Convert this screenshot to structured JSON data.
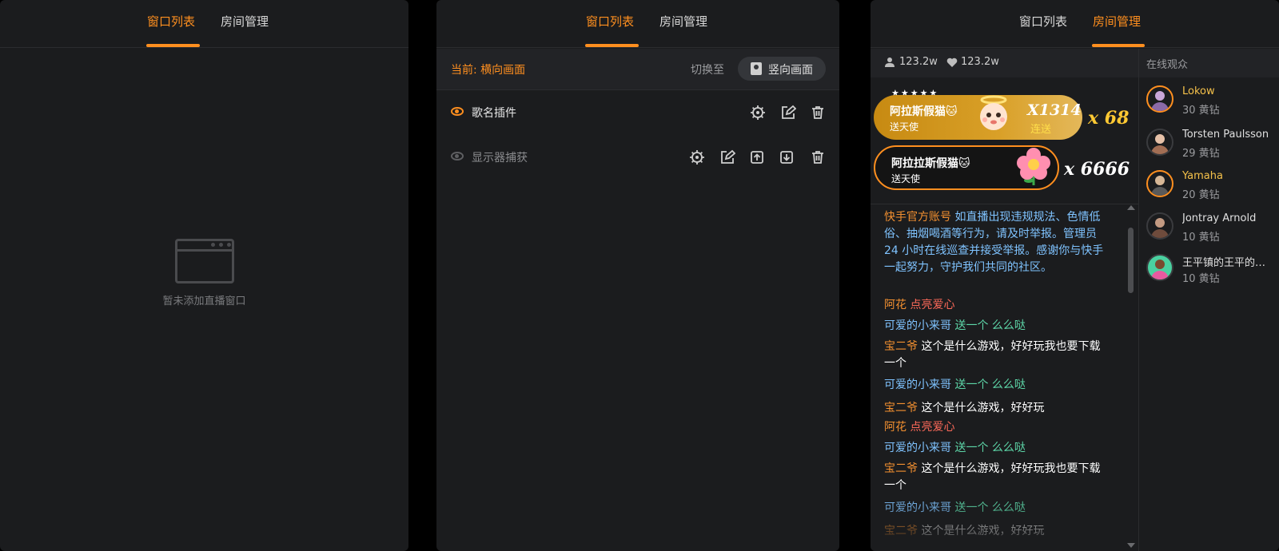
{
  "panel_list": {
    "tabs": [
      {
        "label": "窗口列表"
      },
      {
        "label": "房间管理"
      }
    ],
    "empty_text": "暂未添加直播窗口"
  },
  "panel_plugins": {
    "tabs": [
      {
        "label": "窗口列表"
      },
      {
        "label": "房间管理"
      }
    ],
    "current_label": "当前: 横向画面",
    "switch_label": "切换至",
    "switch_button": "竖向画面",
    "plugins": [
      {
        "name": "歌名插件",
        "visible": true
      },
      {
        "name": "显示器捕获",
        "visible": false
      }
    ]
  },
  "panel_room": {
    "tabs": [
      {
        "label": "窗口列表"
      },
      {
        "label": "房间管理"
      }
    ],
    "stats": {
      "viewers": "123.2w",
      "likes": "123.2w"
    },
    "gifts": [
      {
        "user": "阿拉斯假猫🐱",
        "action": "送天使",
        "count": "X1314",
        "combo_label": "连送",
        "multiplier": "x 68"
      },
      {
        "user": "阿拉拉斯假猫🐱",
        "action": "送天使",
        "multiplier": "x 6666"
      }
    ],
    "gift_stars": "★★★★★",
    "chat": [
      {
        "user": "快手官方账号",
        "text": "如直播出现违规规法、色情低俗、抽烟喝酒等行为，请及时举报。管理员 24 小时在线巡查并接受举报。感谢你与快手一起努力，守护我们共同的社区。"
      },
      {
        "user": "阿花",
        "text": "点亮爱心"
      },
      {
        "user": "可爱的小来哥",
        "text": "送一个 么么哒"
      },
      {
        "user": "宝二爷",
        "text": "这个是什么游戏，好好玩我也要下载一个"
      },
      {
        "user": "可爱的小来哥",
        "text": "送一个 么么哒"
      },
      {
        "user": "宝二爷",
        "text": "这个是什么游戏，好好玩"
      },
      {
        "user": "阿花",
        "text": "点亮爱心"
      },
      {
        "user": "可爱的小来哥",
        "text": "送一个 么么哒"
      },
      {
        "user": "宝二爷",
        "text": "这个是什么游戏，好好玩我也要下载一个"
      },
      {
        "user": "可爱的小来哥",
        "text": "送一个 么么哒"
      },
      {
        "user": "宝二爷",
        "text": "这个是什么游戏，好好玩"
      }
    ],
    "audience_title": "在线观众",
    "audience": [
      {
        "name": "Lokow",
        "diamonds": "30 黄钻"
      },
      {
        "name": "Torsten Paulsson",
        "diamonds": "29 黄钻"
      },
      {
        "name": "Yamaha",
        "diamonds": "20 黄钻"
      },
      {
        "name": "Jontray Arnold",
        "diamonds": "10 黄钻"
      },
      {
        "name": "王平镇的王平的…",
        "diamonds": "10 黄钻"
      }
    ]
  },
  "colors": {
    "accent": "#ff8f1f",
    "panel_bg": "#1b1c1e",
    "system_text": "#7fc3ff"
  }
}
